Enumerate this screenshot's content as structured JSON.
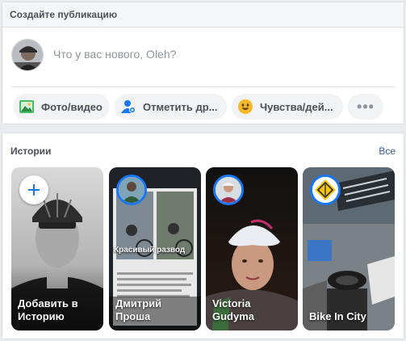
{
  "composer": {
    "title": "Создайте публикацию",
    "placeholder": "Что у вас нового, Oleh?",
    "actions": [
      {
        "label": "Фото/видео",
        "icon": "photo-icon"
      },
      {
        "label": "Отметить др...",
        "icon": "tag-friends-icon"
      },
      {
        "label": "Чувства/дей...",
        "icon": "feeling-emoji-icon"
      },
      {
        "label": "•••",
        "icon": "more-icon"
      }
    ]
  },
  "stories": {
    "title": "Истории",
    "see_all": "Все",
    "items": [
      {
        "name": "Добавить в Историю"
      },
      {
        "name": "Дмитрий Проша",
        "caption": "Красивый развод"
      },
      {
        "name": "Victoria Gudyma"
      },
      {
        "name": "Bike In City"
      }
    ]
  },
  "colors": {
    "accent": "#1877f2",
    "link": "#385898",
    "bg": "#e9ebee"
  }
}
